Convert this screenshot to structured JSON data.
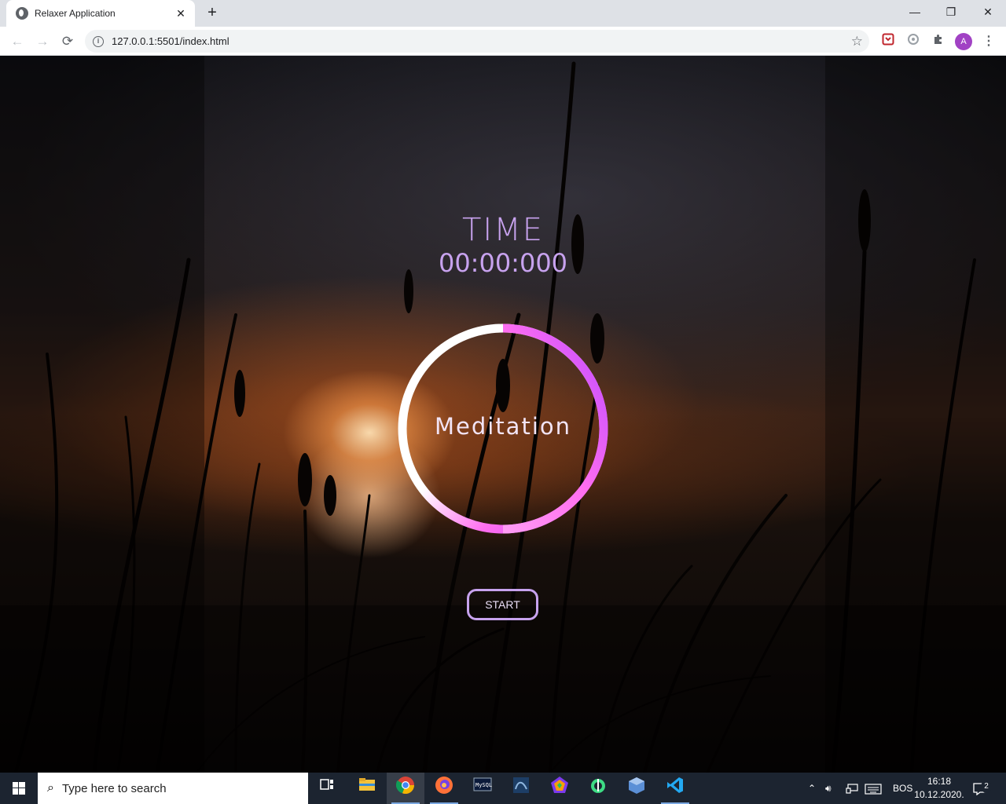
{
  "browser": {
    "tab_title": "Relaxer Application",
    "tab_close": "✕",
    "new_tab": "+",
    "url": "127.0.0.1:5501/index.html",
    "profile_initial": "A",
    "window_controls": {
      "minimize": "—",
      "restore": "❐",
      "close": "✕"
    }
  },
  "app": {
    "time_label": "TIME",
    "timer": "00:00:000",
    "mode": "Meditation",
    "start_label": "START",
    "ring_colors": [
      "#ffffff",
      "#ff6ef0",
      "#c04cff"
    ]
  },
  "taskbar": {
    "search_placeholder": "Type here to search",
    "language": "BOS",
    "time": "16:18",
    "date": "10.12.2020.",
    "notification_count": "2",
    "apps": [
      "task-view",
      "file-explorer",
      "chrome",
      "firefox",
      "terminal",
      "mysql-workbench",
      "polymer-app",
      "android-studio",
      "virtualbox",
      "vscode"
    ]
  }
}
